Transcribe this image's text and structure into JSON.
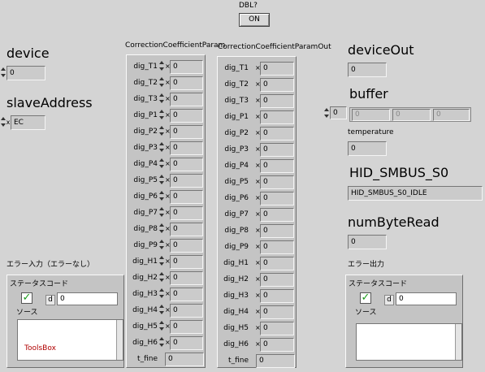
{
  "dbl": {
    "label": "DBL?",
    "button": "ON"
  },
  "device": {
    "label": "device",
    "value": "0"
  },
  "slave_address": {
    "label": "slaveAddress",
    "radix": "x",
    "value": "EC"
  },
  "coeff_in": {
    "label": "CorrectionCoefficientParam",
    "rows": [
      {
        "name": "dig_T1",
        "value": "0"
      },
      {
        "name": "dig_T2",
        "value": "0"
      },
      {
        "name": "dig_T3",
        "value": "0"
      },
      {
        "name": "dig_P1",
        "value": "0"
      },
      {
        "name": "dig_P2",
        "value": "0"
      },
      {
        "name": "dig_P3",
        "value": "0"
      },
      {
        "name": "dig_P4",
        "value": "0"
      },
      {
        "name": "dig_P5",
        "value": "0"
      },
      {
        "name": "dig_P6",
        "value": "0"
      },
      {
        "name": "dig_P7",
        "value": "0"
      },
      {
        "name": "dig_P8",
        "value": "0"
      },
      {
        "name": "dig_P9",
        "value": "0"
      },
      {
        "name": "dig_H1",
        "value": "0"
      },
      {
        "name": "dig_H2",
        "value": "0"
      },
      {
        "name": "dig_H3",
        "value": "0"
      },
      {
        "name": "dig_H4",
        "value": "0"
      },
      {
        "name": "dig_H5",
        "value": "0"
      },
      {
        "name": "dig_H6",
        "value": "0"
      }
    ],
    "tfine": {
      "name": "t_fine",
      "value": "0"
    }
  },
  "coeff_out": {
    "label": "CorrectionCoefficientParamOut",
    "rows": [
      {
        "name": "dig_T1",
        "value": "0"
      },
      {
        "name": "dig_T2",
        "value": "0"
      },
      {
        "name": "dig_T3",
        "value": "0"
      },
      {
        "name": "dig_P1",
        "value": "0"
      },
      {
        "name": "dig_P2",
        "value": "0"
      },
      {
        "name": "dig_P3",
        "value": "0"
      },
      {
        "name": "dig_P4",
        "value": "0"
      },
      {
        "name": "dig_P5",
        "value": "0"
      },
      {
        "name": "dig_P6",
        "value": "0"
      },
      {
        "name": "dig_P7",
        "value": "0"
      },
      {
        "name": "dig_P8",
        "value": "0"
      },
      {
        "name": "dig_P9",
        "value": "0"
      },
      {
        "name": "dig_H1",
        "value": "0"
      },
      {
        "name": "dig_H2",
        "value": "0"
      },
      {
        "name": "dig_H3",
        "value": "0"
      },
      {
        "name": "dig_H4",
        "value": "0"
      },
      {
        "name": "dig_H5",
        "value": "0"
      },
      {
        "name": "dig_H6",
        "value": "0"
      }
    ],
    "tfine": {
      "name": "t_fine",
      "value": "0"
    }
  },
  "device_out": {
    "label": "deviceOut",
    "value": "0"
  },
  "buffer": {
    "label": "buffer",
    "index": "0",
    "values": [
      "0",
      "0",
      "0"
    ]
  },
  "temperature": {
    "label": "temperature",
    "value": "0"
  },
  "hid_smbus": {
    "label": "HID_SMBUS_S0",
    "value": "HID_SMBUS_S0_IDLE"
  },
  "num_byte_read": {
    "label": "numByteRead",
    "value": "0"
  },
  "error_in": {
    "label": "エラー入力（エラーなし）",
    "status_label": "ステータスコード",
    "code_radix": "d",
    "code": "0",
    "source_label": "ソース",
    "source_text": "ToolsBox"
  },
  "error_out": {
    "label": "エラー出力",
    "status_label": "ステータスコード",
    "code_radix": "d",
    "code": "0",
    "source_label": "ソース",
    "source_text": ""
  },
  "colors": {
    "background": "#d4d4d4",
    "check": "#1a9a1a",
    "source_text": "#b00000"
  }
}
